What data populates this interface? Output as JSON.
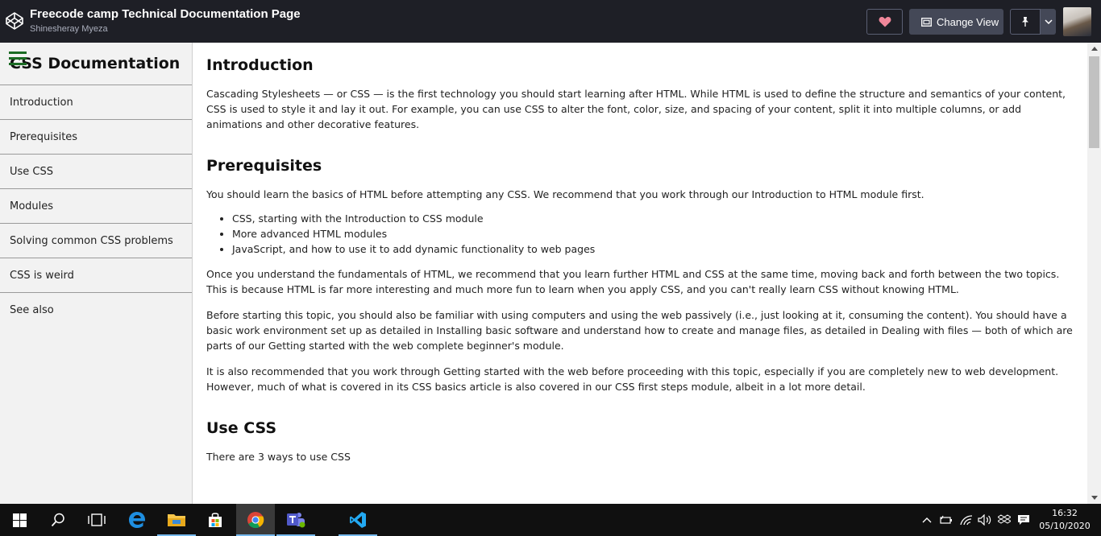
{
  "header": {
    "title": "Freecode camp Technical Documentation Page",
    "author": "Shinesheray Myeza",
    "change_view_label": "Change View"
  },
  "nav": {
    "title": "CSS Documentation",
    "items": [
      {
        "label": "Introduction"
      },
      {
        "label": "Prerequisites"
      },
      {
        "label": "Use CSS"
      },
      {
        "label": "Modules"
      },
      {
        "label": "Solving common CSS problems"
      },
      {
        "label": "CSS is weird"
      },
      {
        "label": "See also"
      }
    ]
  },
  "main": {
    "introduction": {
      "heading": "Introduction",
      "p1": "Cascading Stylesheets — or CSS — is the first technology you should start learning after HTML. While HTML is used to define the structure and semantics of your content, CSS is used to style it and lay it out. For example, you can use CSS to alter the font, color, size, and spacing of your content, split it into multiple columns, or add animations and other decorative features."
    },
    "prerequisites": {
      "heading": "Prerequisites",
      "p1": "You should learn the basics of HTML before attempting any CSS. We recommend that you work through our Introduction to HTML module first.",
      "list": [
        "CSS, starting with the Introduction to CSS module",
        "More advanced HTML modules",
        "JavaScript, and how to use it to add dynamic functionality to web pages"
      ],
      "p2": "Once you understand the fundamentals of HTML, we recommend that you learn further HTML and CSS at the same time, moving back and forth between the two topics. This is because HTML is far more interesting and much more fun to learn when you apply CSS, and you can't really learn CSS without knowing HTML.",
      "p3": "Before starting this topic, you should also be familiar with using computers and using the web passively (i.e., just looking at it, consuming the content). You should have a basic work environment set up as detailed in Installing basic software and understand how to create and manage files, as detailed in Dealing with files — both of which are parts of our Getting started with the web complete beginner's module.",
      "p4": "It is also recommended that you work through Getting started with the web before proceeding with this topic, especially if you are completely new to web development. However, much of what is covered in its CSS basics article is also covered in our CSS first steps module, albeit in a lot more detail."
    },
    "use_css": {
      "heading": "Use CSS",
      "p1": "There are 3 ways to use CSS"
    }
  },
  "taskbar": {
    "time": "16:32",
    "date": "05/10/2020"
  },
  "icons": {
    "logo": "codepen-logo-icon",
    "heart": "heart-icon",
    "view": "change-view-icon",
    "pin": "pin-icon",
    "caret": "chevron-down-icon"
  },
  "colors": {
    "header_bg": "#1e1f26",
    "heart": "#f0879a",
    "hamburger": "#1b6b24",
    "taskbar_bg": "#101010"
  }
}
